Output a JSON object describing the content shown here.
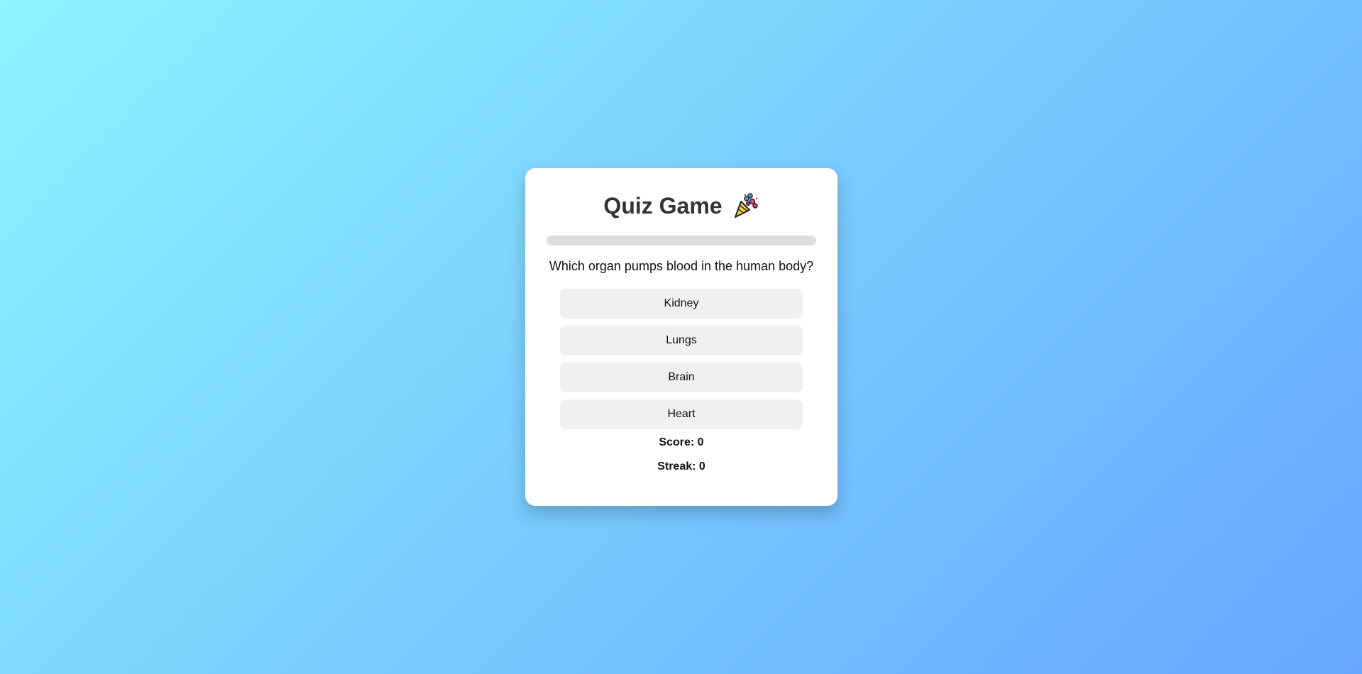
{
  "quiz": {
    "title": "Quiz Game",
    "title_icon": "party-popper-icon",
    "progress": 0,
    "question": "Which organ pumps blood in the human body?",
    "options": [
      {
        "label": "Kidney"
      },
      {
        "label": "Lungs"
      },
      {
        "label": "Brain"
      },
      {
        "label": "Heart"
      }
    ],
    "score_text": "Score: 0",
    "streak_text": "Streak: 0"
  },
  "colors": {
    "background_start": "#8ef4fe",
    "background_end": "#66a6ff",
    "card": "#ffffff",
    "option_bg": "#f0f0f0",
    "progress_track": "#dddddd"
  }
}
